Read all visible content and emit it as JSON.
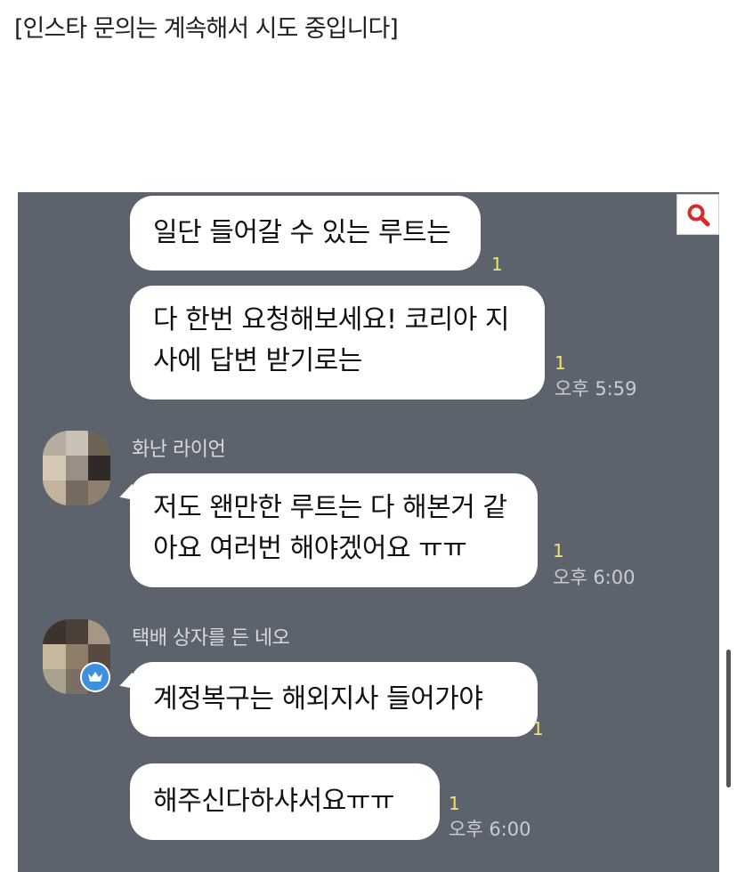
{
  "caption": "[인스타 문의는 계속해서 시도 중입니다]",
  "messages": [
    {
      "lines": [
        "일단 들어갈 수 있는 루트는"
      ],
      "unread": "1",
      "time": ""
    },
    {
      "lines": [
        "다 한번 요청해보세요! 코리아 지",
        "사에 답변 받기로는"
      ],
      "unread": "1",
      "time": "오후 5:59"
    },
    {
      "sender": "화난 라이언",
      "lines": [
        "저도 왠만한 루트는 다 해본거 같",
        "아요 여러번 해야겠어요 ㅠㅠ"
      ],
      "unread": "1",
      "time": "오후 6:00"
    },
    {
      "sender": "택배 상자를 든 네오",
      "lines": [
        "계정복구는 해외지사 들어가야"
      ],
      "unread": "1",
      "time": ""
    },
    {
      "lines": [
        "해주신다하샤서요ㅠㅠ"
      ],
      "unread": "1",
      "time": "오후 6:00"
    }
  ],
  "icons": {
    "search": "search-icon",
    "crown": "crown-icon"
  },
  "colors": {
    "chat_background": "#5d636d",
    "bubble": "#ffffff",
    "unread": "#f2e36a",
    "search_accent": "#d62b2b"
  }
}
